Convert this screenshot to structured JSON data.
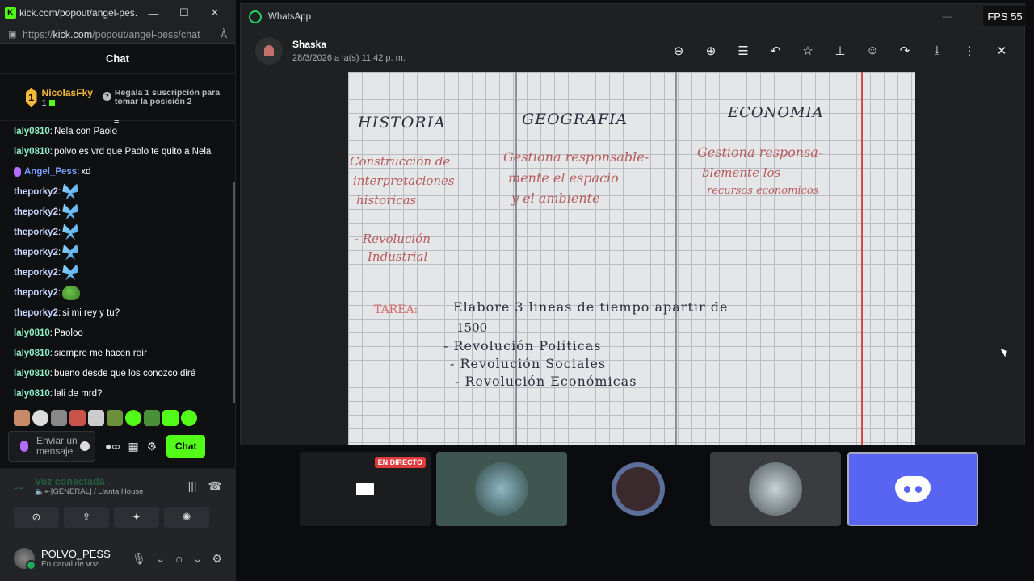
{
  "kick": {
    "window_title": "kick.com/popout/angel-pes...",
    "url_prefix": "https://",
    "url_host": "kick.com",
    "url_path": "/popout/angel-pess/chat",
    "chat_header": "Chat",
    "pinned": {
      "rank": "1",
      "user": "NicolasFky",
      "count": "1",
      "gift_text": "Regala 1 suscripción para tomar la posición 2"
    },
    "messages": [
      {
        "user": "laly0810",
        "text": "Nela con Paolo",
        "kind": "laly"
      },
      {
        "user": "laly0810",
        "text": "polvo es vrd que Paolo te quito a Nela",
        "kind": "laly"
      },
      {
        "user": "Angel_Pess",
        "text": "xd",
        "kind": "angel"
      },
      {
        "user": "theporky2",
        "text": "",
        "kind": "porky-fly"
      },
      {
        "user": "theporky2",
        "text": "",
        "kind": "porky-fly"
      },
      {
        "user": "theporky2",
        "text": "",
        "kind": "porky-fly"
      },
      {
        "user": "theporky2",
        "text": "",
        "kind": "porky-fly"
      },
      {
        "user": "theporky2",
        "text": "",
        "kind": "porky-fly"
      },
      {
        "user": "theporky2",
        "text": "",
        "kind": "porky-frog"
      },
      {
        "user": "theporky2",
        "text": "si mi rey y tu?",
        "kind": "porky"
      },
      {
        "user": "laly0810",
        "text": "Paoloo",
        "kind": "laly"
      },
      {
        "user": "laly0810",
        "text": "siempre me hacen reír",
        "kind": "laly"
      },
      {
        "user": "laly0810",
        "text": "bueno desde que los conozco diré",
        "kind": "laly"
      },
      {
        "user": "laly0810",
        "text": "lali de mrd?",
        "kind": "laly"
      }
    ],
    "input_placeholder": "Enviar un mensaje",
    "send_label": "Chat",
    "accent": "#53fc18"
  },
  "discord": {
    "voice_status": "Voz conectada",
    "voice_channel": "[GENERAL] / Llanta House",
    "username": "POLVO_PESS",
    "user_status": "En canal de voz"
  },
  "whatsapp": {
    "app_title": "WhatsApp",
    "contact": "Shaska",
    "datetime": "28/3/2026 a la(s) 11:42 p. m.",
    "tools": [
      "zoom-out-icon",
      "zoom-in-icon",
      "caption-icon",
      "reply-icon",
      "star-icon",
      "pin-icon",
      "emoji-icon",
      "forward-icon",
      "download-icon",
      "more-icon",
      "close-icon"
    ],
    "note": {
      "col1": "HISTORIA",
      "col2": "GEOGRAFIA",
      "col3": "ECONOMIA",
      "c1_l1": "Construcción de",
      "c1_l2": "interpretaciones",
      "c1_l3": "historicas",
      "c2_l1": "Gestiona responsable-",
      "c2_l2": "mente el espacio",
      "c2_l3": "y el ambiente",
      "c3_l1": "Gestiona responsa-",
      "c3_l2": "blemente los",
      "c3_l3": "recursos economicos",
      "rev1": "- Revolución",
      "rev2": "Industrial",
      "tarea": "TAREA:",
      "task1": "Elabore 3 lineas de tiempo apartir de",
      "task2": "1500",
      "task3": "- Revolución Políticas",
      "task4": "- Revolución Sociales",
      "task5": "- Revolución Económicas"
    }
  },
  "fps": "FPS 55",
  "thumbnails": {
    "live_label": "EN DIRECTO"
  }
}
